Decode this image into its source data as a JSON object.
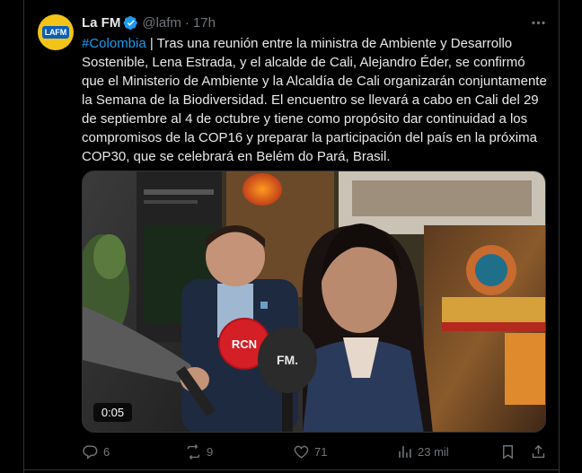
{
  "post": {
    "author_name": "La FM",
    "handle": "@lafm",
    "separator": "·",
    "time": "17h",
    "avatar_text_la": "LA",
    "avatar_text_fm": "FM",
    "hashtag": "#Colombia",
    "text": " | Tras una reunión entre la ministra de Ambiente y Desarrollo Sostenible, Lena Estrada, y el alcalde de Cali, Alejandro Éder, se confirmó que el Ministerio de Ambiente y la Alcaldía de Cali organizarán conjuntamente la Semana de la Biodiversidad. El encuentro se llevará a cabo en Cali del 29 de septiembre al 4 de octubre y tiene como propósito dar continuidad a los compromisos de la COP16 y preparar la participación del país en la próxima COP30, que se celebrará en Belém do Pará, Brasil."
  },
  "video": {
    "duration": "0:05",
    "mic_left_label": "RCN",
    "mic_right_label": "FM."
  },
  "actions": {
    "replies": "6",
    "reposts": "9",
    "likes": "71",
    "views": "23 mil"
  },
  "colors": {
    "accent": "#1d9bf0",
    "muted": "#71767b",
    "text": "#e7e9ea",
    "background": "#000000",
    "border": "#2f3336",
    "avatar_bg": "#f2c418"
  },
  "icons": [
    "verified-badge-icon",
    "more-icon",
    "reply-icon",
    "repost-icon",
    "like-icon",
    "views-icon",
    "bookmark-icon",
    "share-icon"
  ]
}
